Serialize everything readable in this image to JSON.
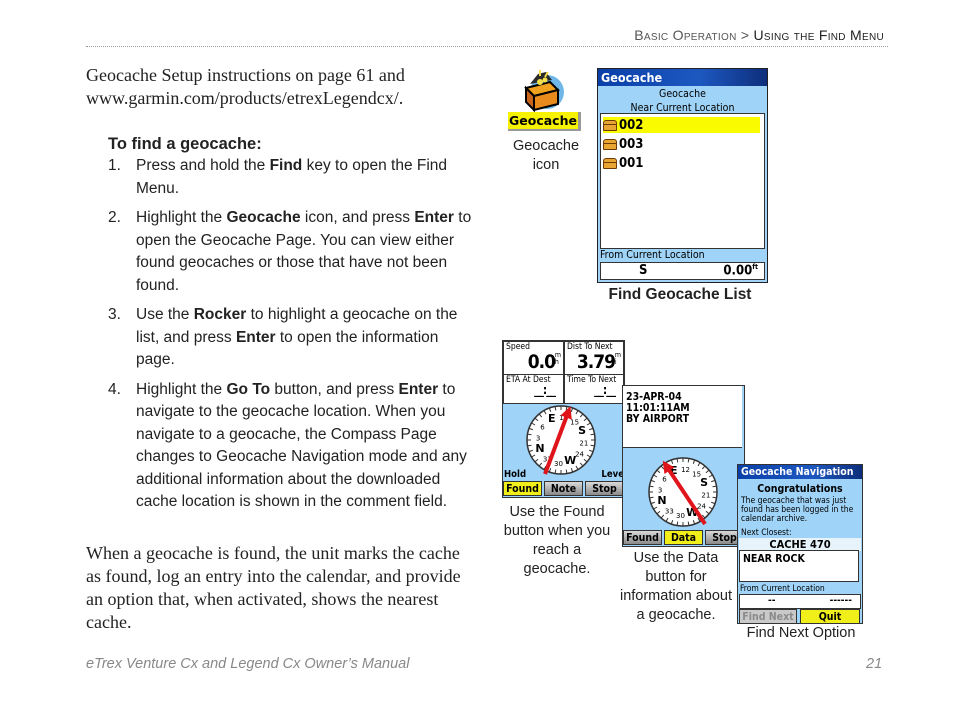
{
  "header": {
    "section": "Basic Operation",
    "separator": ">",
    "current": "Using the Find Menu"
  },
  "intro": "Geocache Setup instructions on page 61 and www.garmin.com/products/etrexLegendcx/.",
  "procedure": {
    "heading": "To find a geocache:",
    "steps": [
      {
        "num": "1.",
        "parts": [
          "Press and hold the ",
          "Find",
          " key to open the Find Menu."
        ]
      },
      {
        "num": "2.",
        "parts": [
          "Highlight the ",
          "Geocache",
          " icon, and press ",
          "Enter",
          " to open the Geocache Page. You can view either found geocaches or those that have not been found."
        ]
      },
      {
        "num": "3.",
        "parts": [
          "Use the ",
          "Rocker",
          " to highlight a geocache on the list, and press ",
          "Enter",
          " to open the information page."
        ]
      },
      {
        "num": "4.",
        "parts": [
          "Highlight the ",
          "Go To",
          " button, and press ",
          "Enter",
          " to navigate to the geocache location. When you navigate to a geocache, the Compass Page changes to Geocache Navigation mode and any additional information about the downloaded cache location is shown in the comment field."
        ]
      }
    ]
  },
  "outro": "When a geocache is found, the unit marks the cache as found, log an entry into the calendar, and provide an option that, when activated, shows the nearest cache.",
  "footer": {
    "title": "eTrex Venture Cx and Legend Cx Owner’s Manual",
    "page": "21"
  },
  "figures": {
    "geocache_icon": {
      "label": "Geocache",
      "caption": "Geocache icon"
    },
    "find_list": {
      "title": "Geocache",
      "subtitle1": "Geocache",
      "subtitle2": "Near Current Location",
      "items": [
        "002",
        "003",
        "001"
      ],
      "selected_index": 0,
      "from_label": "From Current Location",
      "direction": "S",
      "distance": "0.00",
      "distance_unit": "ft",
      "caption": "Find Geocache List"
    },
    "trip_screen": {
      "speed_label": "Speed",
      "speed_value": "0.0",
      "speed_unit": "mh",
      "dist_label": "Dist To Next",
      "dist_value": "3.79",
      "dist_unit": "mi",
      "eta_label": "ETA At Dest",
      "eta_value": "__:__",
      "time_label": "Time To Next",
      "time_value": "__:__",
      "compass_labels": [
        "12",
        "15",
        "S",
        "21",
        "24",
        "W",
        "30",
        "33",
        "N",
        "3",
        "6",
        "E"
      ],
      "hold_label": "Hold",
      "level_label": "Leve",
      "buttons": [
        "Found",
        "Note",
        "Stop"
      ],
      "highlighted_button": "Found",
      "caption": "Use the Found button when you reach a geocache."
    },
    "data_screen": {
      "comment_line1": "23-APR-04 11:01:11AM",
      "comment_line2": "BY AIRPORT",
      "compass_labels": [
        "12",
        "15",
        "S",
        "21",
        "24",
        "W",
        "30",
        "33",
        "N",
        "3",
        "6",
        "E"
      ],
      "buttons": [
        "Found",
        "Data",
        "Stop"
      ],
      "highlighted_button": "Data",
      "caption": "Use the Data button for information about a geocache."
    },
    "nav_screen": {
      "title": "Geocache Navigation",
      "congrats": "Congratulations",
      "message": "The geocache that was just found has been logged in the calendar archive.",
      "next_label": "Next Closest:",
      "cache_name": "CACHE 470",
      "cache_comment": "NEAR ROCK",
      "from_label": "From Current Location",
      "direction": "--",
      "distance": "------",
      "buttons": [
        "Find Next",
        "Quit"
      ],
      "highlighted_button": "Quit",
      "disabled_button": "Find Next",
      "caption": "Find Next Option"
    }
  },
  "colors": {
    "screen_bg": "#9fd3f7",
    "highlight": "#fbfb00",
    "titlebar": "#0a3fa8",
    "arrow": "#e0141b"
  }
}
